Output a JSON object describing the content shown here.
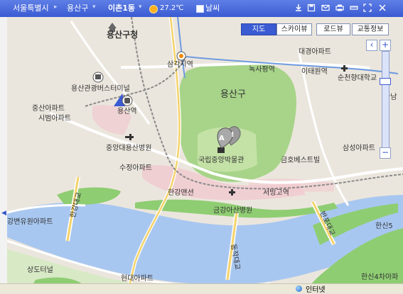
{
  "toolbar": {
    "region": "서울특별시",
    "district": "용산구",
    "dong": "이촌1동",
    "temperature": "27.2℃",
    "weather_label": "날씨",
    "icons": [
      "download-icon",
      "save-icon",
      "mail-icon",
      "print-icon",
      "ruler-icon",
      "fullscreen-icon",
      "close-icon"
    ]
  },
  "map_types": [
    "지도",
    "스카이뷰",
    "로드뷰",
    "교통정보"
  ],
  "active_map_type": "지도",
  "zoom": {
    "plus": "+",
    "minus": "−",
    "level_fraction": 0.28
  },
  "map_labels": {
    "yongsan_gu_office": "용산구청",
    "samgakji": "삼각지역",
    "daegyeong_apt": "대경아파트",
    "noksapyeong": "녹사평역",
    "itaewon": "이태원역",
    "yongsan_gu": "용산구",
    "soonchunhyang": "순천향대학교",
    "hannam": "한남",
    "yongsan_terminal": "용산관광버스터미널",
    "jungsan_apt": "중산아파트",
    "sibeom_apt": "시범아파트",
    "yongsan_station": "용산역",
    "central_hospital": "중앙대용산병원",
    "sujeong_apt": "수정아파트",
    "museum": "국립중앙박물관",
    "geumho_bestville": "금호베스트빌",
    "samsung_apt": "삼성아파트",
    "hangang_mansion": "한강맨션",
    "seobinggo_station": "서빙고역",
    "geumgang_hospital": "금강아산병원",
    "hangang_bridge": "한강대교",
    "banpo_bridge": "반포대교",
    "dongjak_bridge": "동작대교",
    "hanshin5": "한신5",
    "riverside_apt": "강변유원아파트",
    "sangdo_tunnel": "상도터널",
    "hyundai_apt": "현대아파트",
    "hanshin4": "한신4차아파",
    "marker_a": "A",
    "marker_b": "!"
  },
  "taskbar": {
    "label": "인터넷"
  }
}
